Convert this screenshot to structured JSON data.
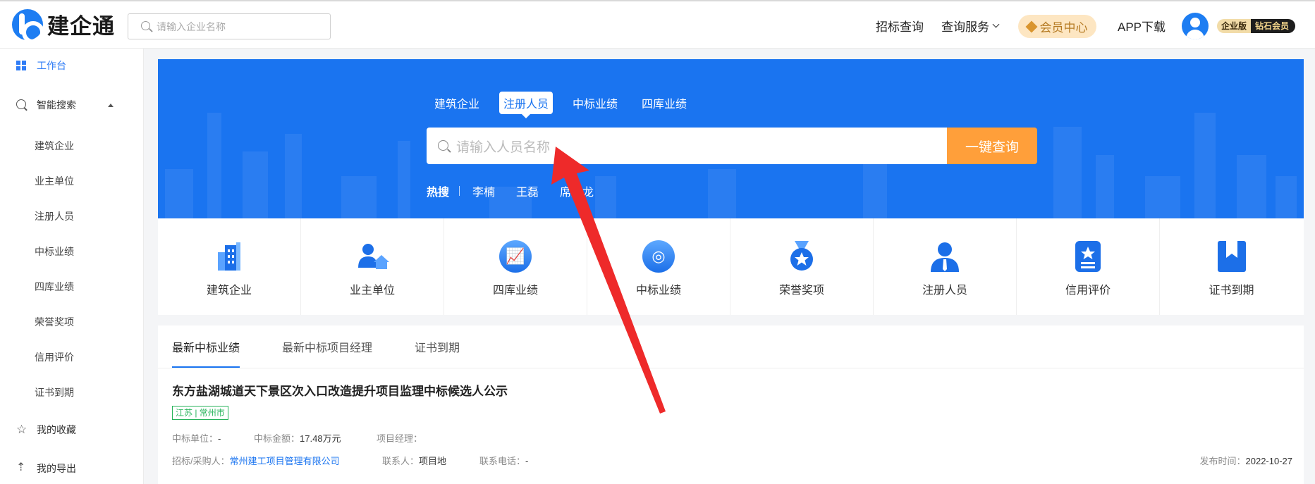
{
  "header": {
    "logo_text": "建企通",
    "search_placeholder": "请输入企业名称",
    "nav_bid": "招标查询",
    "nav_service": "查询服务",
    "vip_center": "会员中心",
    "app_download": "APP下载",
    "badge_enterprise": "企业版",
    "badge_level": "钻石会员"
  },
  "sidebar": {
    "workbench": "工作台",
    "smart_search": "智能搜索",
    "sub_items": [
      "建筑企业",
      "业主单位",
      "注册人员",
      "中标业绩",
      "四库业绩",
      "荣誉奖项",
      "信用评价",
      "证书到期"
    ],
    "favorites": "我的收藏",
    "exports": "我的导出"
  },
  "hero": {
    "tabs": [
      "建筑企业",
      "注册人员",
      "中标业绩",
      "四库业绩"
    ],
    "active_tab": "注册人员",
    "search_placeholder": "请输入人员名称",
    "search_button": "一键查询",
    "hot_label": "热搜",
    "hot_keywords": [
      "李楠",
      "王磊",
      "席亚龙"
    ]
  },
  "shortcuts": [
    "建筑企业",
    "业主单位",
    "四库业绩",
    "中标业绩",
    "荣誉奖项",
    "注册人员",
    "信用评价",
    "证书到期"
  ],
  "panel": {
    "tabs": [
      "最新中标业绩",
      "最新中标项目经理",
      "证书到期"
    ],
    "active_tab": "最新中标业绩",
    "item": {
      "title": "东方盐湖城道天下景区次入口改造提升项目监理中标候选人公示",
      "region_tag": "江苏 | 常州市",
      "winner_label": "中标单位：",
      "winner_value": "-",
      "amount_label": "中标金额：",
      "amount_value": "17.48万元",
      "pm_label": "项目经理：",
      "pm_value": "",
      "buyer_label": "招标/采购人：",
      "buyer_value": "常州建工项目管理有限公司",
      "contact_label": "联系人：",
      "contact_value": "项目地",
      "phone_label": "联系电话：",
      "phone_value": "-",
      "publish_label": "发布时间：",
      "publish_value": "2022-10-27"
    }
  },
  "colors": {
    "brand_blue": "#1a74f0",
    "button_orange": "#ff9f3a",
    "tag_green": "#27b35a",
    "annotation_red": "#ee2a2a"
  }
}
